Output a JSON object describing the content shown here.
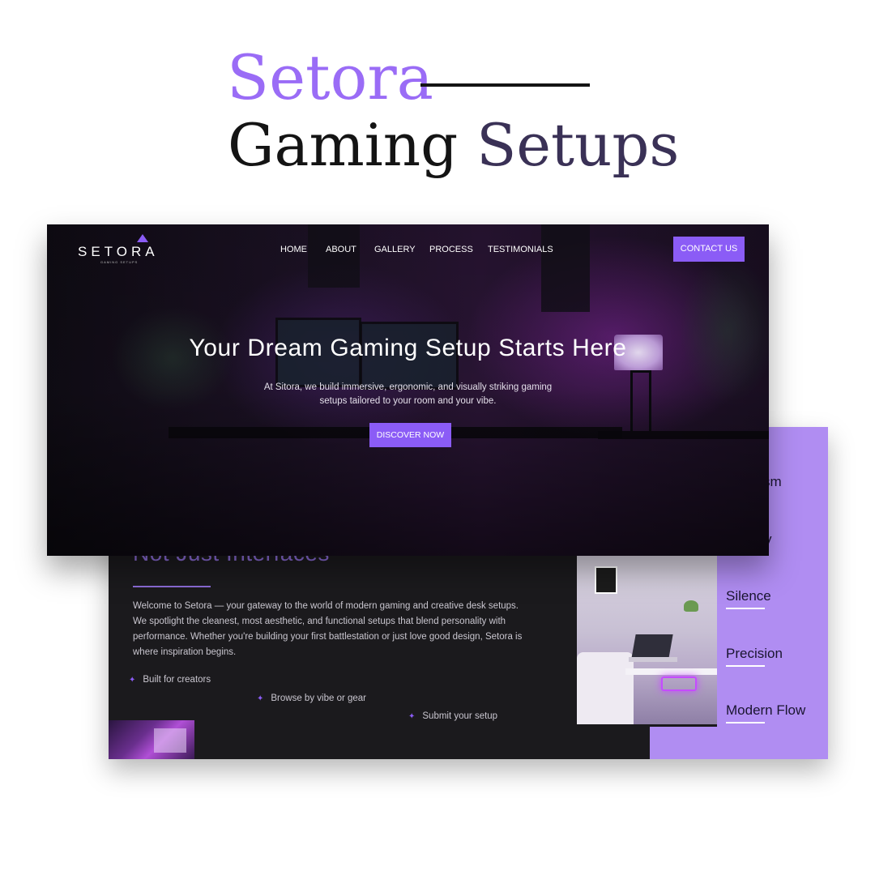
{
  "headline": {
    "brand": "Setora",
    "line_part1": "Gaming",
    "line_part2": "Setups"
  },
  "hero": {
    "logo_word": "SETORA",
    "logo_sub": "GAMING SETUPS",
    "nav": [
      "HOME",
      "ABOUT",
      "GALLERY",
      "PROCESS",
      "TESTIMONIALS"
    ],
    "contact_label": "CONTACT US",
    "title": "Your Dream Gaming Setup Starts Here",
    "subtitle": "At Sitora, we build immersive, ergonomic, and visually striking gaming setups tailored to your room and your vibe.",
    "cta_label": "DISCOVER NOW"
  },
  "about": {
    "title_visible": "Not Just Interfaces",
    "body": "Welcome to Setora — your gateway to the world of modern gaming and creative desk setups. We spotlight the cleanest, most aesthetic, and functional setups that blend personality with performance. Whether you're building your first battlestation or just love good design, Setora is where inspiration begins.",
    "features": [
      "Built for creators",
      "Browse by vibe or gear",
      "Submit your setup"
    ]
  },
  "values_panel": {
    "items": [
      "alism",
      "vity",
      "Silence",
      "Precision",
      "Modern Flow"
    ]
  },
  "colors": {
    "accent": "#8b5cf6",
    "brand_purple": "#9a6cf6",
    "panel_lavender": "#b08df2",
    "dark_bg": "#1b1a1d"
  }
}
